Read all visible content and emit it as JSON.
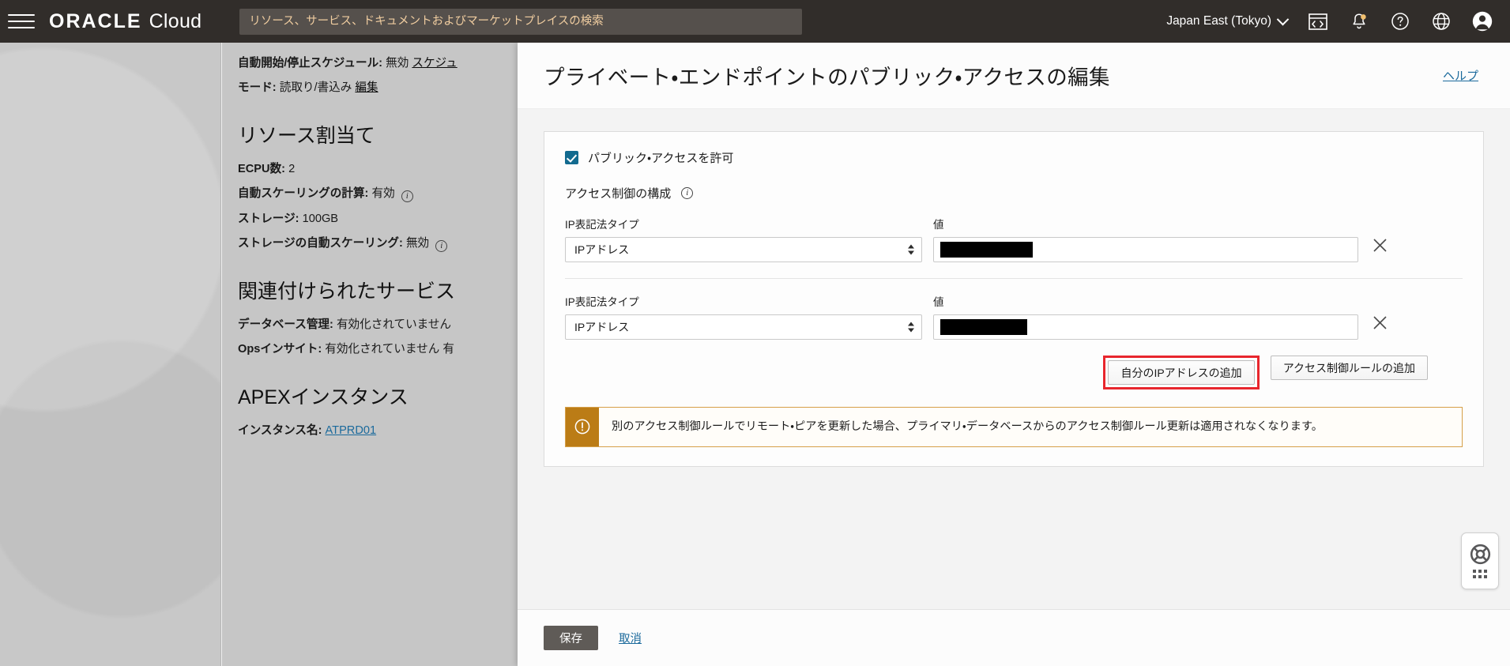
{
  "header": {
    "brand_oracle": "ORACLE",
    "brand_cloud": "Cloud",
    "search_placeholder": "リソース、サービス、ドキュメントおよびマーケットプレイスの検索",
    "search_value": "",
    "region": "Japan East (Tokyo)",
    "icons": [
      "hamburger-menu-icon",
      "cloud-shell-icon",
      "notifications-bell-icon",
      "help-question-icon",
      "language-globe-icon",
      "user-avatar-icon"
    ]
  },
  "detail_pane": {
    "lines": [
      {
        "label": "自動開始/停止スケジュール:",
        "value": "無効",
        "link": "スケジュ"
      },
      {
        "label": "モード:",
        "value": "読取り/書込み",
        "link": "編集"
      }
    ],
    "section_resource": {
      "title": "リソース割当て",
      "rows": [
        {
          "label": "ECPU数:",
          "value": "2",
          "info": false
        },
        {
          "label": "自動スケーリングの計算:",
          "value": "有効",
          "info": true
        },
        {
          "label": "ストレージ:",
          "value": "100GB",
          "info": false
        },
        {
          "label": "ストレージの自動スケーリング:",
          "value": "無効",
          "info": true
        }
      ]
    },
    "section_services": {
      "title": "関連付けられたサービス",
      "rows": [
        {
          "label": "データベース管理:",
          "value": "有効化されていません",
          "info": false
        },
        {
          "label": "Opsインサイト:",
          "value": "有効化されていません 有",
          "info": false
        }
      ]
    },
    "section_apex": {
      "title": "APEXインスタンス",
      "rows": [
        {
          "label": "インスタンス名:",
          "value": "ATPRD01",
          "info": false
        }
      ]
    }
  },
  "overlay": {
    "title": "プライベート・エンドポイントのパブリック・アクセスの編集",
    "help_label": "ヘルプ",
    "allow_public_access_label": "パブリック・アクセスを許可",
    "allow_public_access_checked": true,
    "access_control_label": "アクセス制御の構成",
    "rules": [
      {
        "type_label": "IP表記法タイプ",
        "type_value": "IPアドレス",
        "value_label": "値",
        "value_redacted": true
      },
      {
        "type_label": "IP表記法タイプ",
        "type_value": "IPアドレス",
        "value_label": "値",
        "value_redacted": true
      }
    ],
    "add_my_ip_label": "自分のIPアドレスの追加",
    "add_rule_label": "アクセス制御ルールの追加",
    "warning_text": "別のアクセス制御ルールでリモート・ピアを更新した場合、プライマリ・データベースからのアクセス制御ルール更新は適用されなくなります。",
    "save_label": "保存",
    "cancel_label": "取消"
  },
  "support_widget": {
    "name": "support-lifebuoy-icon"
  },
  "colors": {
    "topbar_bg": "#312d2a",
    "search_bg": "#55504c",
    "search_text": "#f0cda0",
    "link": "#1b6a9c",
    "checkbox": "#126a8f",
    "warning_bar": "#bb7c16",
    "warning_border": "#d6a04a",
    "highlight_red": "#e8262d",
    "save_btn": "#5f5b57"
  }
}
